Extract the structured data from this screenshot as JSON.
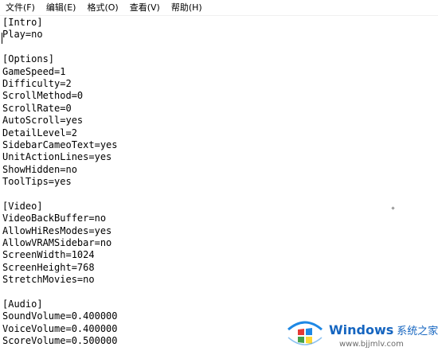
{
  "menu": {
    "items": [
      "文件(F)",
      "编辑(E)",
      "格式(O)",
      "查看(V)",
      "帮助(H)"
    ]
  },
  "document": {
    "lines": [
      "[Intro]",
      "Play=no",
      "",
      "[Options]",
      "GameSpeed=1",
      "Difficulty=2",
      "ScrollMethod=0",
      "ScrollRate=0",
      "AutoScroll=yes",
      "DetailLevel=2",
      "SidebarCameoText=yes",
      "UnitActionLines=yes",
      "ShowHidden=no",
      "ToolTips=yes",
      "",
      "[Video]",
      "VideoBackBuffer=no",
      "AllowHiResModes=yes",
      "AllowVRAMSidebar=no",
      "ScreenWidth=1024",
      "ScreenHeight=768",
      "StretchMovies=no",
      "",
      "[Audio]",
      "SoundVolume=0.400000",
      "VoiceVolume=0.400000",
      "ScoreVolume=0.500000"
    ]
  },
  "watermark": {
    "brand": "Windows",
    "subtitle": "系统之家",
    "url": "www.bjjmlv.com",
    "logo_colors": [
      "#e53935",
      "#1e88e5",
      "#43a047",
      "#fdd835"
    ]
  }
}
